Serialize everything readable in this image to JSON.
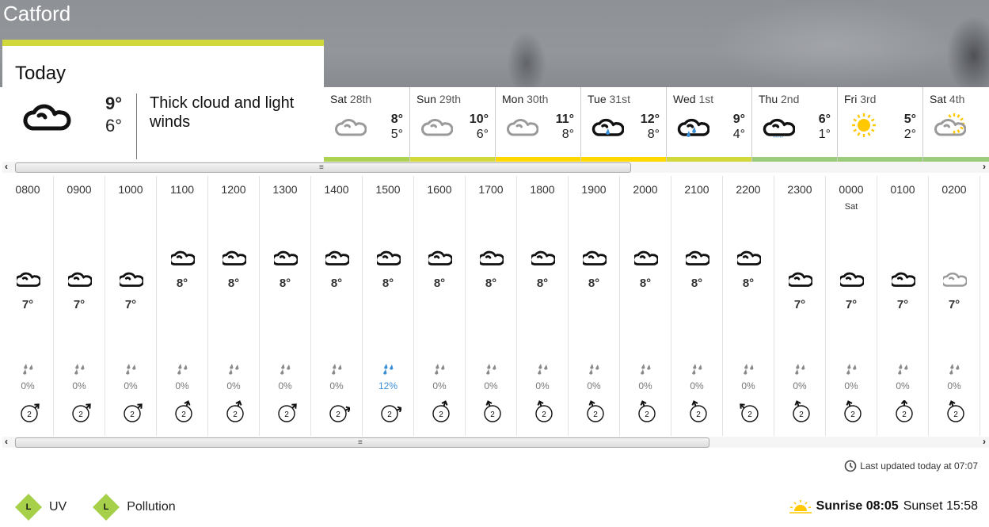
{
  "location": "Catford",
  "today": {
    "label": "Today",
    "icon": "thick-cloud-icon",
    "high": "9°",
    "low": "6°",
    "description": "Thick cloud and light winds"
  },
  "days": [
    {
      "name": "Sat",
      "num": "28th",
      "icon": "light-cloud-icon",
      "high": "8°",
      "low": "5°",
      "bar_color": "#add150"
    },
    {
      "name": "Sun",
      "num": "29th",
      "icon": "light-cloud-icon",
      "high": "10°",
      "low": "6°",
      "bar_color": "#d1d83b"
    },
    {
      "name": "Mon",
      "num": "30th",
      "icon": "light-cloud-icon",
      "high": "11°",
      "low": "8°",
      "bar_color": "#ffd800"
    },
    {
      "name": "Tue",
      "num": "31st",
      "icon": "light-rain-icon",
      "high": "12°",
      "low": "8°",
      "bar_color": "#ffd800"
    },
    {
      "name": "Wed",
      "num": "1st",
      "icon": "heavy-rain-icon",
      "high": "9°",
      "low": "4°",
      "bar_color": "#d1d83b"
    },
    {
      "name": "Thu",
      "num": "2nd",
      "icon": "drizzle-icon",
      "high": "6°",
      "low": "1°",
      "bar_color": "#9ccc7b"
    },
    {
      "name": "Fri",
      "num": "3rd",
      "icon": "sunny-icon",
      "high": "5°",
      "low": "2°",
      "bar_color": "#9ccc7b"
    },
    {
      "name": "Sat",
      "num": "4th",
      "icon": "sunny-intervals-icon",
      "high": "5°",
      "low": "2°",
      "bar_color": "#9ccc7b"
    }
  ],
  "hours": [
    {
      "time": "0800",
      "day": "",
      "icon": "thick-cloud-icon",
      "temp": "7°",
      "tval": 7,
      "rain": "0%",
      "wet": false,
      "wind_speed": "2",
      "wind_dir": 45
    },
    {
      "time": "0900",
      "day": "",
      "icon": "thick-cloud-icon",
      "temp": "7°",
      "tval": 7,
      "rain": "0%",
      "wet": false,
      "wind_speed": "2",
      "wind_dir": 45
    },
    {
      "time": "1000",
      "day": "",
      "icon": "thick-cloud-icon",
      "temp": "7°",
      "tval": 7,
      "rain": "0%",
      "wet": false,
      "wind_speed": "2",
      "wind_dir": 45
    },
    {
      "time": "1100",
      "day": "",
      "icon": "thick-cloud-icon",
      "temp": "8°",
      "tval": 8,
      "rain": "0%",
      "wet": false,
      "wind_speed": "2",
      "wind_dir": 20
    },
    {
      "time": "1200",
      "day": "",
      "icon": "thick-cloud-icon",
      "temp": "8°",
      "tval": 8,
      "rain": "0%",
      "wet": false,
      "wind_speed": "2",
      "wind_dir": 20
    },
    {
      "time": "1300",
      "day": "",
      "icon": "thick-cloud-icon",
      "temp": "8°",
      "tval": 8,
      "rain": "0%",
      "wet": false,
      "wind_speed": "2",
      "wind_dir": 45
    },
    {
      "time": "1400",
      "day": "",
      "icon": "thick-cloud-icon",
      "temp": "8°",
      "tval": 8,
      "rain": "0%",
      "wet": false,
      "wind_speed": "2",
      "wind_dir": 65
    },
    {
      "time": "1500",
      "day": "",
      "icon": "thick-cloud-icon",
      "temp": "8°",
      "tval": 8,
      "rain": "12%",
      "wet": true,
      "wind_speed": "2",
      "wind_dir": 65
    },
    {
      "time": "1600",
      "day": "",
      "icon": "thick-cloud-icon",
      "temp": "8°",
      "tval": 8,
      "rain": "0%",
      "wet": false,
      "wind_speed": "2",
      "wind_dir": 20
    },
    {
      "time": "1700",
      "day": "",
      "icon": "thick-cloud-icon",
      "temp": "8°",
      "tval": 8,
      "rain": "0%",
      "wet": false,
      "wind_speed": "2",
      "wind_dir": -20
    },
    {
      "time": "1800",
      "day": "",
      "icon": "thick-cloud-icon",
      "temp": "8°",
      "tval": 8,
      "rain": "0%",
      "wet": false,
      "wind_speed": "2",
      "wind_dir": -20
    },
    {
      "time": "1900",
      "day": "",
      "icon": "thick-cloud-icon",
      "temp": "8°",
      "tval": 8,
      "rain": "0%",
      "wet": false,
      "wind_speed": "2",
      "wind_dir": -20
    },
    {
      "time": "2000",
      "day": "",
      "icon": "thick-cloud-icon",
      "temp": "8°",
      "tval": 8,
      "rain": "0%",
      "wet": false,
      "wind_speed": "2",
      "wind_dir": -20
    },
    {
      "time": "2100",
      "day": "",
      "icon": "thick-cloud-icon",
      "temp": "8°",
      "tval": 8,
      "rain": "0%",
      "wet": false,
      "wind_speed": "2",
      "wind_dir": -20
    },
    {
      "time": "2200",
      "day": "",
      "icon": "thick-cloud-icon",
      "temp": "8°",
      "tval": 8,
      "rain": "0%",
      "wet": false,
      "wind_speed": "2",
      "wind_dir": -45
    },
    {
      "time": "2300",
      "day": "",
      "icon": "thick-cloud-icon",
      "temp": "7°",
      "tval": 7,
      "rain": "0%",
      "wet": false,
      "wind_speed": "2",
      "wind_dir": -20
    },
    {
      "time": "0000",
      "day": "Sat",
      "icon": "thick-cloud-icon",
      "temp": "7°",
      "tval": 7,
      "rain": "0%",
      "wet": false,
      "wind_speed": "2",
      "wind_dir": -20
    },
    {
      "time": "0100",
      "day": "",
      "icon": "thick-cloud-icon",
      "temp": "7°",
      "tval": 7,
      "rain": "0%",
      "wet": false,
      "wind_speed": "2",
      "wind_dir": 0
    },
    {
      "time": "0200",
      "day": "",
      "icon": "light-cloud-icon",
      "temp": "7°",
      "tval": 7,
      "rain": "0%",
      "wet": false,
      "wind_speed": "2",
      "wind_dir": -20
    }
  ],
  "footer": {
    "last_updated": "Last updated today at 07:07",
    "uv_level": "L",
    "uv_label": "UV",
    "pollution_level": "L",
    "pollution_label": "Pollution",
    "sunrise": "Sunrise 08:05",
    "sunset": "Sunset 15:58"
  },
  "colors": {
    "accent": "#d1d83b",
    "rain_blue": "#3a8ed6",
    "badge_green": "#a6cf4a",
    "sun_yellow": "#ffc800"
  }
}
